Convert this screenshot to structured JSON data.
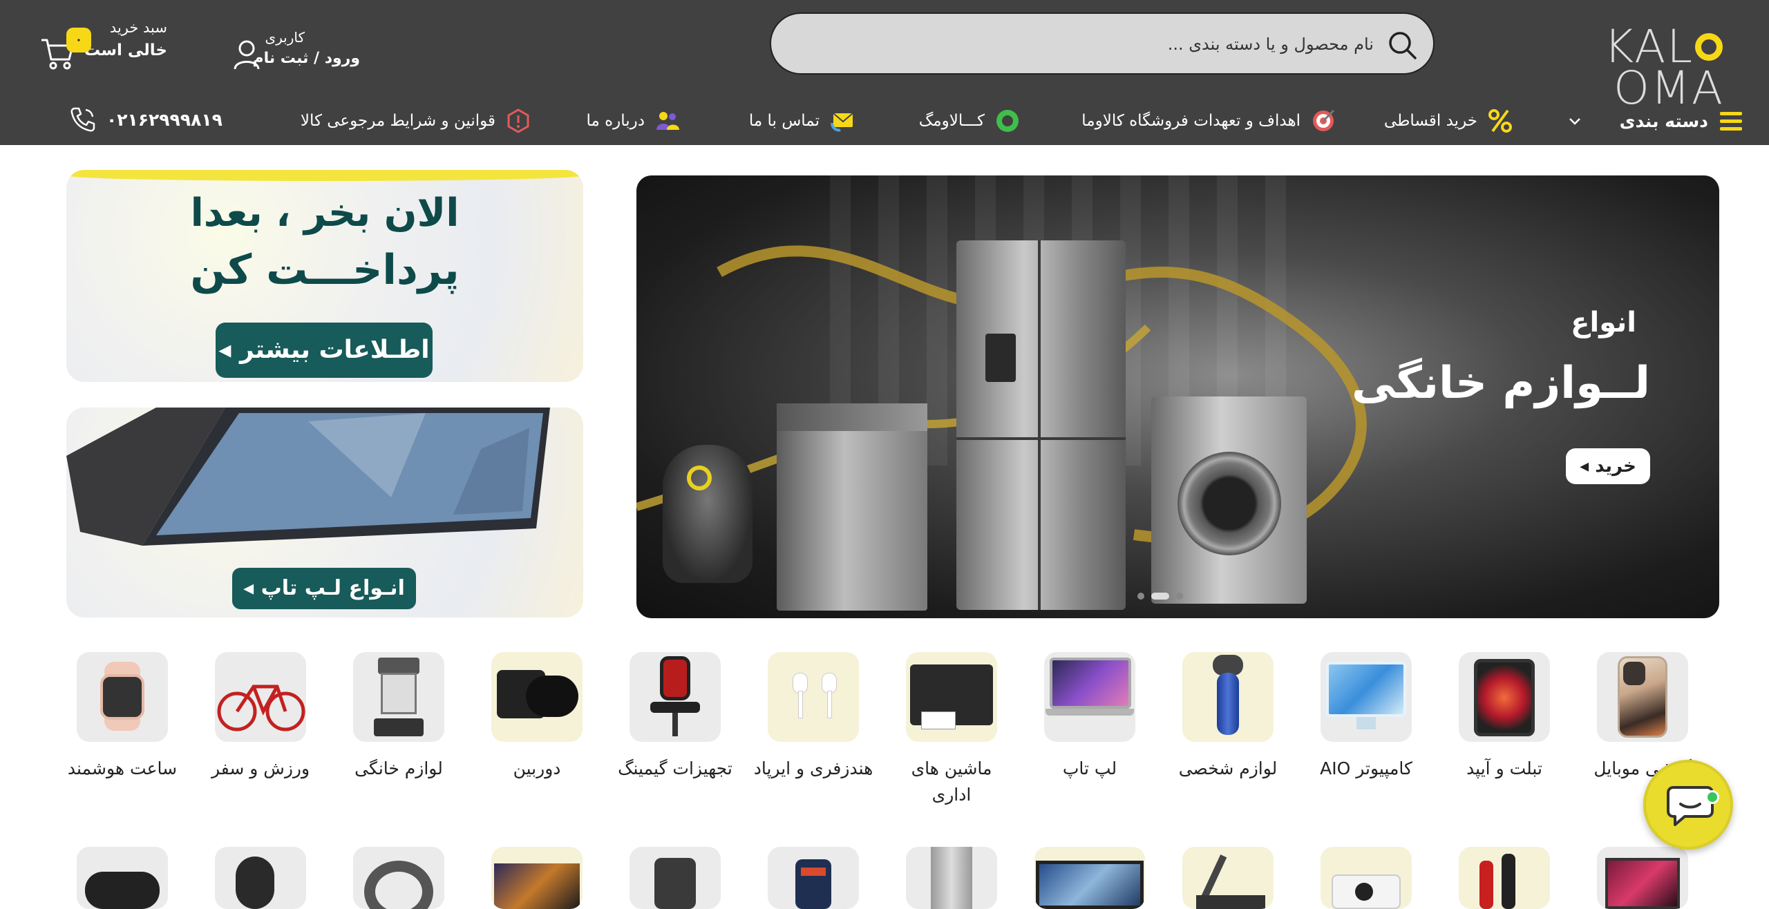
{
  "header": {
    "logo_text": "kalaoma",
    "search": {
      "placeholder": "نام محصول و یا دسته بندی ..."
    },
    "user": {
      "label": "کاربری",
      "action": "ورود / ثبت نام"
    },
    "cart": {
      "title": "سبد خرید",
      "status": "خالی است",
      "count": "۰"
    }
  },
  "nav": {
    "categories": "دسته بندی",
    "installment": "خرید اقساطی",
    "goals": "اهداف و تعهدات فروشگاه کالاوما",
    "blog": "کـــالاومگ",
    "contact": "تماس با ما",
    "about": "درباره ما",
    "rules": "قوانین و شرایط مرجوعی کالا",
    "phone": "۰۲۱۶۲۹۹۹۸۱۹"
  },
  "hero": {
    "small": "انواع",
    "big": "لــوازم خانگی",
    "button": "خرید ◂",
    "slides": 3,
    "active_slide": 2
  },
  "promo1": {
    "line1": "الان بخر ، بعدا",
    "line2": "پرداخـــت کن",
    "button": "اطـلاعات بیشتر ◂"
  },
  "promo2": {
    "button": "انـواع لـپ تاپ ◂"
  },
  "categories": [
    {
      "label": "ساعت هوشمند"
    },
    {
      "label": "ورزش و سفر"
    },
    {
      "label": "لوازم خانگی"
    },
    {
      "label": "دوربین"
    },
    {
      "label": "تجهیزات گیمینگ"
    },
    {
      "label": "هندزفری و ایرپاد"
    },
    {
      "label": "ماشین های اداری"
    },
    {
      "label": "لپ تاپ"
    },
    {
      "label": "لوازم شخصی"
    },
    {
      "label": "کامپیوتر AIO"
    },
    {
      "label": "تبلت و آیپد"
    },
    {
      "label": "گوشی موبایل"
    }
  ],
  "colors": {
    "header_bg": "#414141",
    "accent": "#f7d817",
    "teal": "#175b5a"
  }
}
